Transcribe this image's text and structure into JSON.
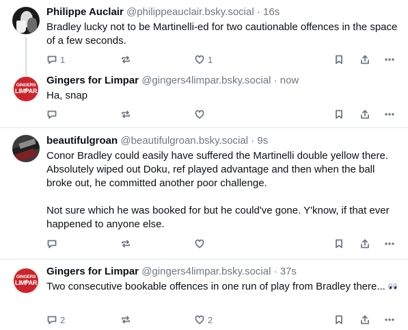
{
  "posts": [
    {
      "name": "Philippe Auclair",
      "handle": "@philippeauclair.bsky.social",
      "separator": "·",
      "time": "16s",
      "text": "Bradley lucky not to be Martinelli-ed for two cautionable offences in the space of a few seconds.",
      "reply_count": "1",
      "repost_count": "",
      "like_count": "1"
    },
    {
      "name": "Gingers for Limpar",
      "handle": "@gingers4limpar.bsky.social",
      "separator": "·",
      "time": "now",
      "text": "Ha, snap",
      "reply_count": "",
      "repost_count": "",
      "like_count": ""
    },
    {
      "name": "beautifulgroan",
      "handle": "@beautifulgroan.bsky.social",
      "separator": "·",
      "time": "9s",
      "text": "Conor Bradley could easily have suffered the Martinelli double yellow there. Absolutely wiped out Doku, ref played advantage and then when the ball broke out, he committed another poor challenge.\n\nNot sure which he was booked for but he could've gone. Y'know, if that ever happened to anyone else.",
      "reply_count": "",
      "repost_count": "",
      "like_count": ""
    },
    {
      "name": "Gingers for Limpar",
      "handle": "@gingers4limpar.bsky.social",
      "separator": "·",
      "time": "37s",
      "text": "Two consecutive bookable offences in one run of play from Bradley there...",
      "reply_count": "2",
      "repost_count": "",
      "like_count": "2"
    }
  ],
  "avatar_logo": {
    "line1": "GINGERS 4",
    "line2": "LIMPAR"
  },
  "icons": {
    "reply": "reply-icon",
    "repost": "repost-icon",
    "like": "like-icon",
    "bookmark": "bookmark-icon",
    "share": "share-icon",
    "more": "more-icon",
    "emoji": "eyes-emoji"
  },
  "colors": {
    "text": "#0b0f14",
    "muted": "#6f7780",
    "divider": "#e3e8ee",
    "thread_line": "#d4dbe2",
    "brand_red": "#c8262e"
  }
}
